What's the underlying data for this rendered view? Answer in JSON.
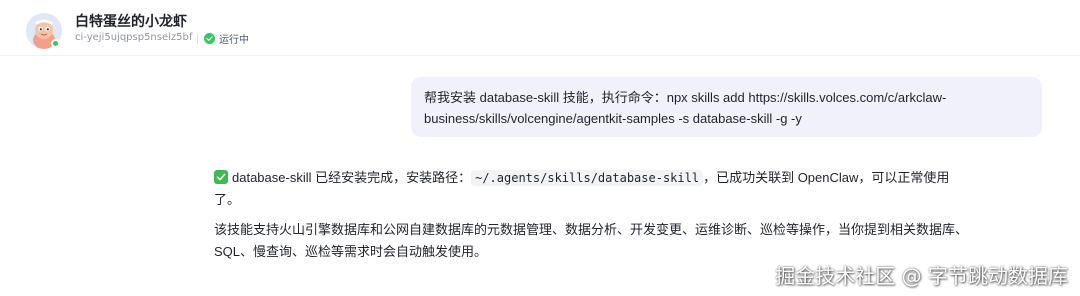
{
  "header": {
    "agent_name": "白特蛋丝的小龙虾",
    "agent_id": "ci-yeji5ujqpsp5nseiz5bf",
    "status_text": "运行中",
    "status_color": "#34c759"
  },
  "chat": {
    "user_message": {
      "line1": "帮我安装 database-skill 技能，执行命令：npx skills add https://skills.volces.com/c/arkclaw-",
      "line2": "business/skills/volcengine/agentkit-samples -s database-skill -g -y"
    },
    "assistant_message": {
      "check_icon": "check-mark-icon",
      "line1_prefix": "database-skill 已经安装完成，安装路径：",
      "install_path": "~/.agents/skills/database-skill",
      "line1_suffix": "，已成功关联到 OpenClaw，可以正常使用",
      "line2": "了。",
      "para2_line1": "该技能支持火山引擎数据库和公网自建数据库的元数据管理、数据分析、开发变更、运维诊断、巡检等操作，当你提到相关数据库、",
      "para2_line2": "SQL、慢查询、巡检等需求时会自动触发使用。"
    }
  },
  "watermark": "掘金技术社区 @ 字节跳动数据库"
}
